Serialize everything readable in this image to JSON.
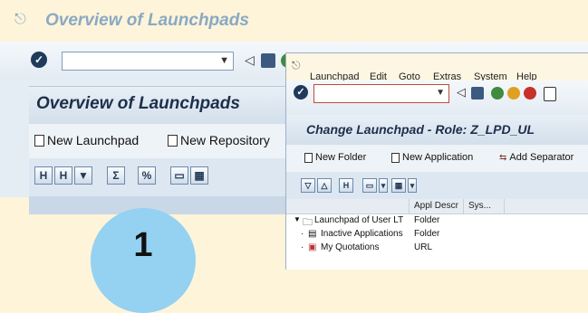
{
  "back_window": {
    "title": "Overview of Launchpads",
    "heading": "Overview of Launchpads",
    "buttons": {
      "new_launchpad": "New Launchpad",
      "new_repository": "New Repository"
    }
  },
  "front_window": {
    "menu": [
      "Launchpad",
      "Edit",
      "Goto",
      "Extras",
      "System",
      "Help"
    ],
    "heading": "Change Launchpad - Role: Z_LPD_UL",
    "buttons": {
      "new_folder": "New Folder",
      "new_application": "New Application",
      "add_separator": "Add Separator"
    },
    "tree": {
      "columns": [
        "Appl Descr",
        "Sys..."
      ],
      "rows": [
        {
          "label": "Launchpad of User LT",
          "type": "Folder",
          "icon": "folder-icon"
        },
        {
          "label": "Inactive Applications",
          "type": "Folder",
          "icon": "list-icon"
        },
        {
          "label": "My Quotations",
          "type": "URL",
          "icon": "document-icon"
        }
      ]
    }
  },
  "badge": {
    "number": "1",
    "color": "#95d1f1"
  },
  "colors": {
    "accent": "#1d2f4a",
    "background": "#fdf4da"
  }
}
